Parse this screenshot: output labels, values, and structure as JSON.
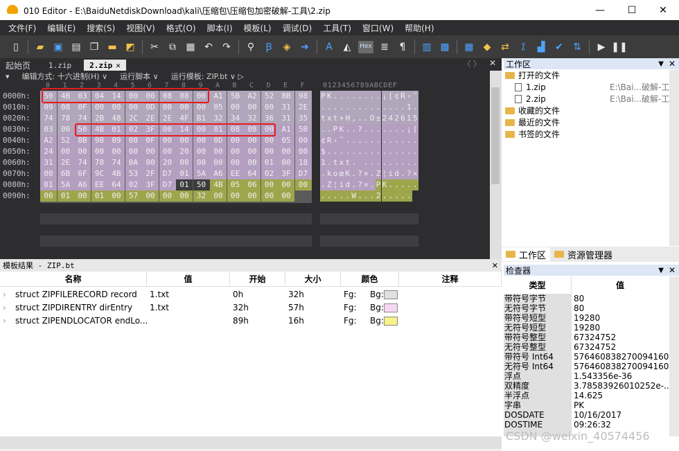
{
  "window": {
    "title": "010 Editor - E:\\BaiduNetdiskDownload\\kali\\压缩包\\压缩包加密破解-工具\\2.zip",
    "minimize_glyph": "—",
    "maximize_glyph": "☐",
    "close_glyph": "✕"
  },
  "menu": [
    "文件(F)",
    "编辑(E)",
    "搜索(S)",
    "视图(V)",
    "格式(O)",
    "脚本(I)",
    "模板(L)",
    "调试(D)",
    "工具(T)",
    "窗口(W)",
    "帮助(H)"
  ],
  "toolbar": {
    "icons": [
      "new-file-icon",
      "open-folder-icon",
      "save-icon",
      "save-as-icon",
      "save-all-icon",
      "open-project-icon",
      "folder-stack-icon",
      "cut-icon",
      "copy-icon",
      "paste-icon",
      "undo-icon",
      "redo-icon",
      "find-icon",
      "replace-icon",
      "find-in-files-icon",
      "goto-icon",
      "text-view-icon",
      "highlight-icon",
      "hex-view-icon",
      "byte-view-icon",
      "pilcrow-icon",
      "columns-icon",
      "binary-icon",
      "calculator-icon",
      "template-icon",
      "compare-icon",
      "checksum-icon",
      "histogram-icon",
      "check-icon",
      "base-convert-icon",
      "run-icon",
      "pause-icon"
    ],
    "hex_label": "Hex"
  },
  "tabs": {
    "start_page": "起始页",
    "items": [
      {
        "label": "1.zip"
      },
      {
        "label": "2.zip",
        "close": "✕"
      }
    ],
    "arrows": "〈 〉",
    "close": "✕"
  },
  "infobar": {
    "mode": "编辑方式: 十六进制(H) ∨",
    "script": "运行脚本 ∨",
    "template": "运行模板: ZIP.bt ∨ ▷"
  },
  "hex": {
    "column_header": "0  1  2  3  4  5  6  7  8  9  A  B  C  D  E  F",
    "ascii_header": "0123456789ABCDEF",
    "offsets": [
      "0000h:",
      "0010h:",
      "0020h:",
      "0030h:",
      "0040h:",
      "0050h:",
      "0060h:",
      "0070h:",
      "0080h:",
      "0090h:"
    ],
    "rows": [
      "50 4B 03 04 14 00 00 08 08 00 A1 5B A2 52 8B 98",
      "09 08 0F 00 00 00 0D 00 00 00 05 00 00 00 31 2E",
      "74 78 74 2B 48 2C 2E 2E 4F B1 32 34 32 36 31 35",
      "03 00 50 4B 01 02 3F 00 14 00 01 08 08 00 A1 5B",
      "A2 52 8B 98 09 08 0F 00 00 00 0D 00 00 00 05 00",
      "24 00 00 00 00 00 00 00 20 00 00 00 00 00 00 00",
      "31 2E 74 78 74 0A 00 20 00 00 00 00 00 01 00 18",
      "00 6B 6F 9C 4B 53 2F D7 01 5A A6 EE 64 02 3F D7",
      "01 5A A6 EE 64 02 3F D7 01 50 4B 05 06 00 00 00",
      "00 01 00 01 00 57 00 00 00 32 00 00 00 00 00"
    ],
    "ascii": [
      "PK........¡[¢R‹˜",
      "..............1.",
      "txt+H,..O±242615",
      "..PK..?.......¡[",
      "¢R‹˜............",
      "$...............",
      "1.txt. .........",
      ".koœK.?×.Z¦id.?×",
      ".Z¦id.?×.PK.....",
      ".....W...2....."
    ],
    "colors": {
      "record": "#b1a6bb",
      "direntry": "#b59fc1",
      "locator": "#9ea64c",
      "dark_row": "#3c3c3c"
    }
  },
  "results": {
    "title": "模板结果 - ZIP.bt",
    "close": "✕",
    "headers": [
      "名称",
      "值",
      "开始",
      "大小",
      "颜色",
      "注释"
    ],
    "rows": [
      {
        "name": "struct ZIPFILERECORD record",
        "value": "1.txt",
        "start": "0h",
        "size": "32h",
        "fg": "Fg:",
        "bg": "Bg:",
        "swatch": "#e0e0e0"
      },
      {
        "name": "struct ZIPDIRENTRY dirEntry",
        "value": "1.txt",
        "start": "32h",
        "size": "57h",
        "fg": "Fg:",
        "bg": "Bg:",
        "swatch": "#f7d6f3"
      },
      {
        "name": "struct ZIPENDLOCATOR endLo...",
        "value": "",
        "start": "89h",
        "size": "16h",
        "fg": "Fg:",
        "bg": "Bg:",
        "swatch": "#f8f28a"
      }
    ]
  },
  "workspace": {
    "title": "工作区",
    "pin": "▼",
    "close": "✕",
    "open_files": "打开的文件",
    "files": [
      {
        "name": "1.zip",
        "path": "E:\\Bai...破解-工具\\"
      },
      {
        "name": "2.zip",
        "path": "E:\\Bai...破解-工具\\"
      }
    ],
    "favorites": "收藏的文件",
    "recent": "最近的文件",
    "bookmarks": "书签的文件"
  },
  "panel_tabs": [
    "工作区",
    "资源管理器"
  ],
  "inspector": {
    "title": "检查器",
    "headers": [
      "类型",
      "值"
    ],
    "rows": [
      {
        "type": "带符号字节",
        "value": "80"
      },
      {
        "type": "无符号字节",
        "value": "80"
      },
      {
        "type": "带符号短型",
        "value": "19280"
      },
      {
        "type": "无符号短型",
        "value": "19280"
      },
      {
        "type": "带符号整型",
        "value": "67324752"
      },
      {
        "type": "无符号整型",
        "value": "67324752"
      },
      {
        "type": "带符号 Int64",
        "value": "576460838270094160"
      },
      {
        "type": "无符号 Int64",
        "value": "576460838270094160"
      },
      {
        "type": "浮点",
        "value": "1.543356e-36"
      },
      {
        "type": "双精度",
        "value": "3.78583926010252e-..."
      },
      {
        "type": "半浮点",
        "value": "14.625"
      },
      {
        "type": "字串",
        "value": "PK"
      },
      {
        "type": "DOSDATE",
        "value": "10/16/2017"
      },
      {
        "type": "DOSTIME",
        "value": "09:26:32"
      }
    ]
  },
  "watermark": "CSDN @weixin_40574456"
}
